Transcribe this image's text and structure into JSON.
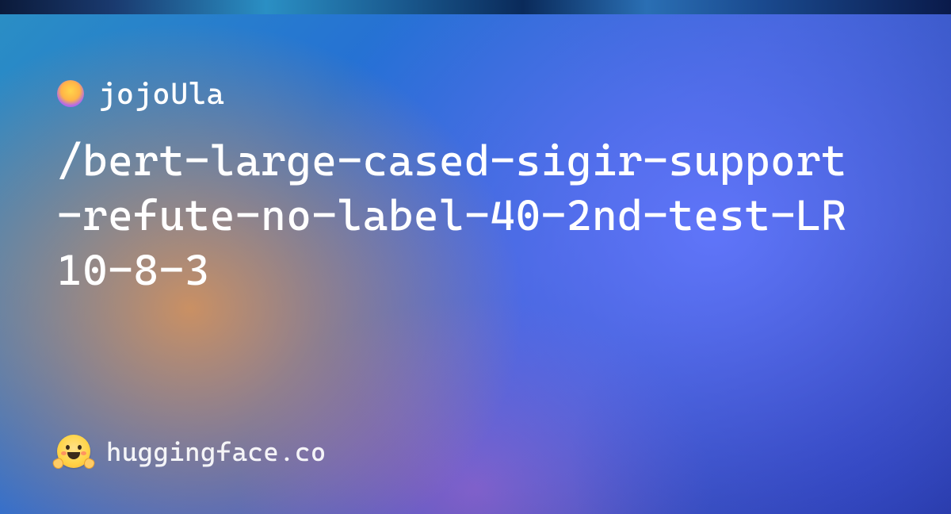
{
  "author": {
    "name": "jojoUla"
  },
  "model": {
    "name": "/bert-large-cased-sigir-support-refute-no-label-40-2nd-test-LR10-8-3"
  },
  "site": {
    "name": "huggingface.co"
  }
}
